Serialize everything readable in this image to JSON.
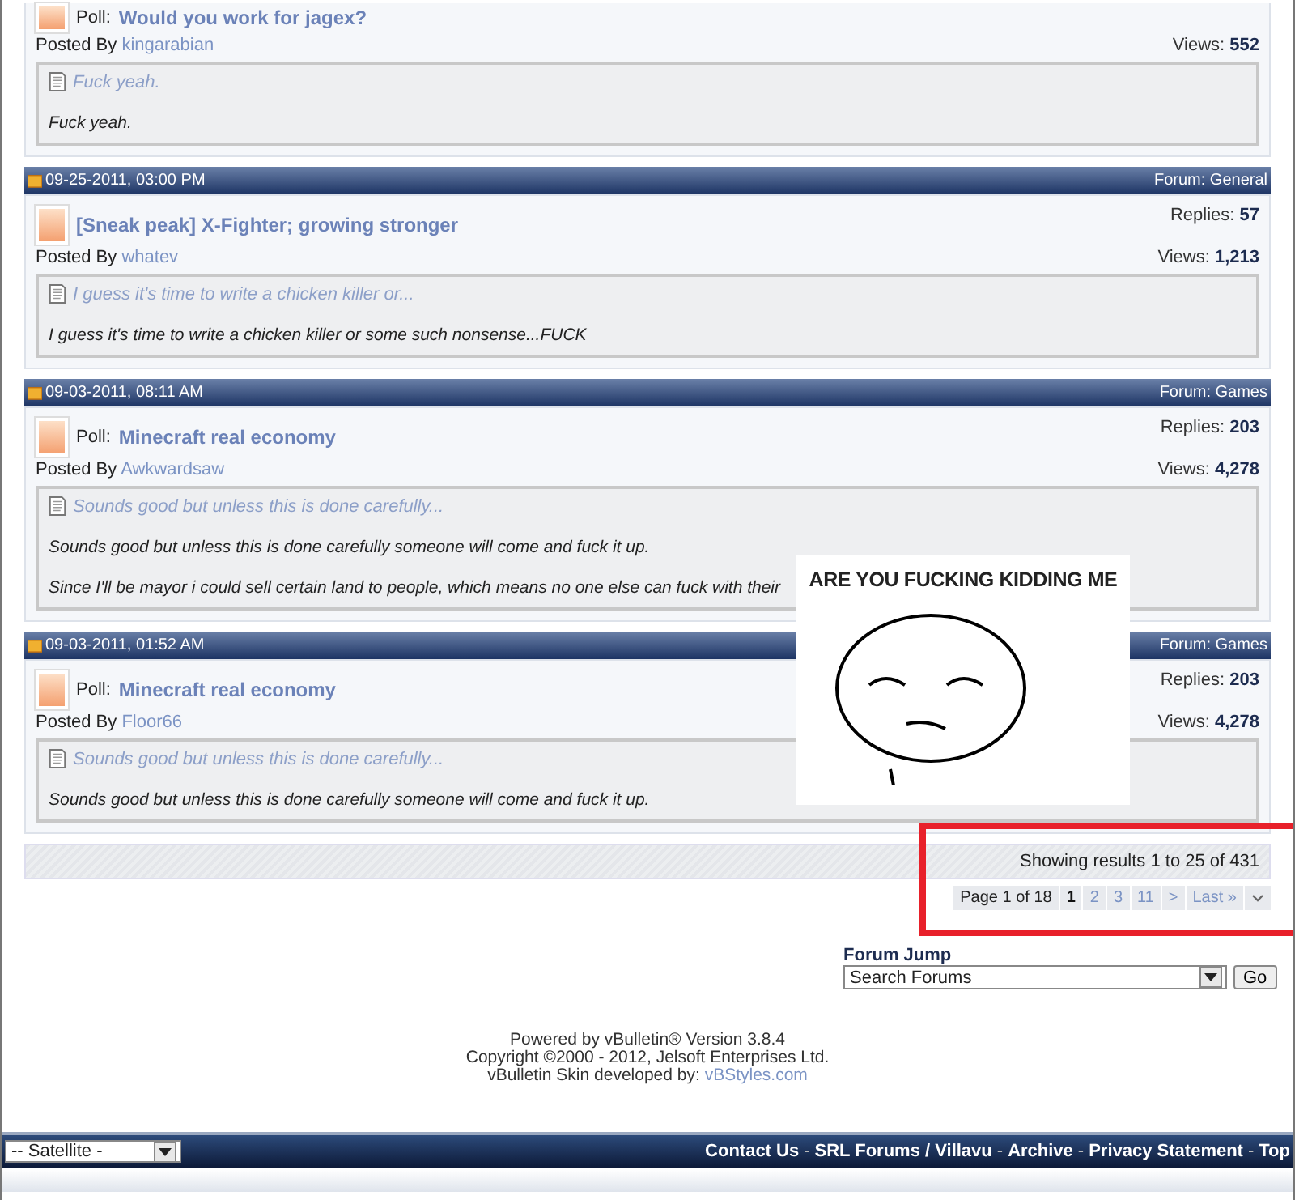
{
  "posts": [
    {
      "prefix": "Poll:",
      "title": "Would you work for jagex?",
      "posted_by_label": "Posted By",
      "author": "kingarabian",
      "views_label": "Views:",
      "views": "552",
      "preview": "Fuck yeah.",
      "body": [
        "Fuck yeah."
      ]
    },
    {
      "date": "09-25-2011, 03:00 PM",
      "forum": "Forum: General",
      "title": "[Sneak peak] X-Fighter; growing stronger",
      "replies_label": "Replies:",
      "replies": "57",
      "posted_by_label": "Posted By",
      "author": "whatev",
      "views_label": "Views:",
      "views": "1,213",
      "preview": "I guess it's time to write a chicken killer or...",
      "body": [
        "I guess it's time to write a chicken killer or some such nonsense...FUCK"
      ]
    },
    {
      "date": "09-03-2011, 08:11 AM",
      "forum": "Forum: Games",
      "prefix": "Poll:",
      "title": "Minecraft real economy",
      "replies_label": "Replies:",
      "replies": "203",
      "posted_by_label": "Posted By",
      "author": "Awkwardsaw",
      "views_label": "Views:",
      "views": "4,278",
      "preview": "Sounds good but unless this is done carefully...",
      "body": [
        "Sounds good but unless this is done carefully someone will come and fuck it up.",
        "Since I'll be mayor i could sell certain land to people, which means no one else can fuck with their"
      ]
    },
    {
      "date": "09-03-2011, 01:52 AM",
      "forum": "Forum: Games",
      "prefix": "Poll:",
      "title": "Minecraft real economy",
      "replies_label": "Replies:",
      "replies": "203",
      "posted_by_label": "Posted By",
      "author": "Floor66",
      "views_label": "Views:",
      "views": "4,278",
      "preview": "Sounds good but unless this is done carefully...",
      "body": [
        "Sounds good but unless this is done carefully someone will come and fuck it up."
      ]
    }
  ],
  "results": "Showing results 1 to 25 of 431",
  "pagination": {
    "label": "Page 1 of 18",
    "pages": [
      {
        "label": "1",
        "selected": true
      },
      {
        "label": "2",
        "selected": false
      },
      {
        "label": "3",
        "selected": false
      },
      {
        "label": "11",
        "selected": false
      },
      {
        "label": ">",
        "selected": false
      },
      {
        "label": "Last »",
        "selected": false
      }
    ]
  },
  "forum_jump": {
    "title": "Forum Jump",
    "value": "Search Forums",
    "button": "Go"
  },
  "footer": {
    "lines": [
      "Powered by vBulletin® Version 3.8.4",
      "Copyright ©2000 - 2012, Jelsoft Enterprises Ltd."
    ],
    "skin_label": "vBulletin Skin developed by:",
    "skin_link": "vBStyles.com"
  },
  "bottom_bar": {
    "style": "-- Satellite -",
    "separator": "-",
    "links": [
      "Contact Us",
      "SRL Forums / Villavu",
      "Archive",
      "Privacy Statement",
      "Top"
    ]
  },
  "meme": {
    "caption": "ARE YOU FUCKING KIDDING ME"
  }
}
